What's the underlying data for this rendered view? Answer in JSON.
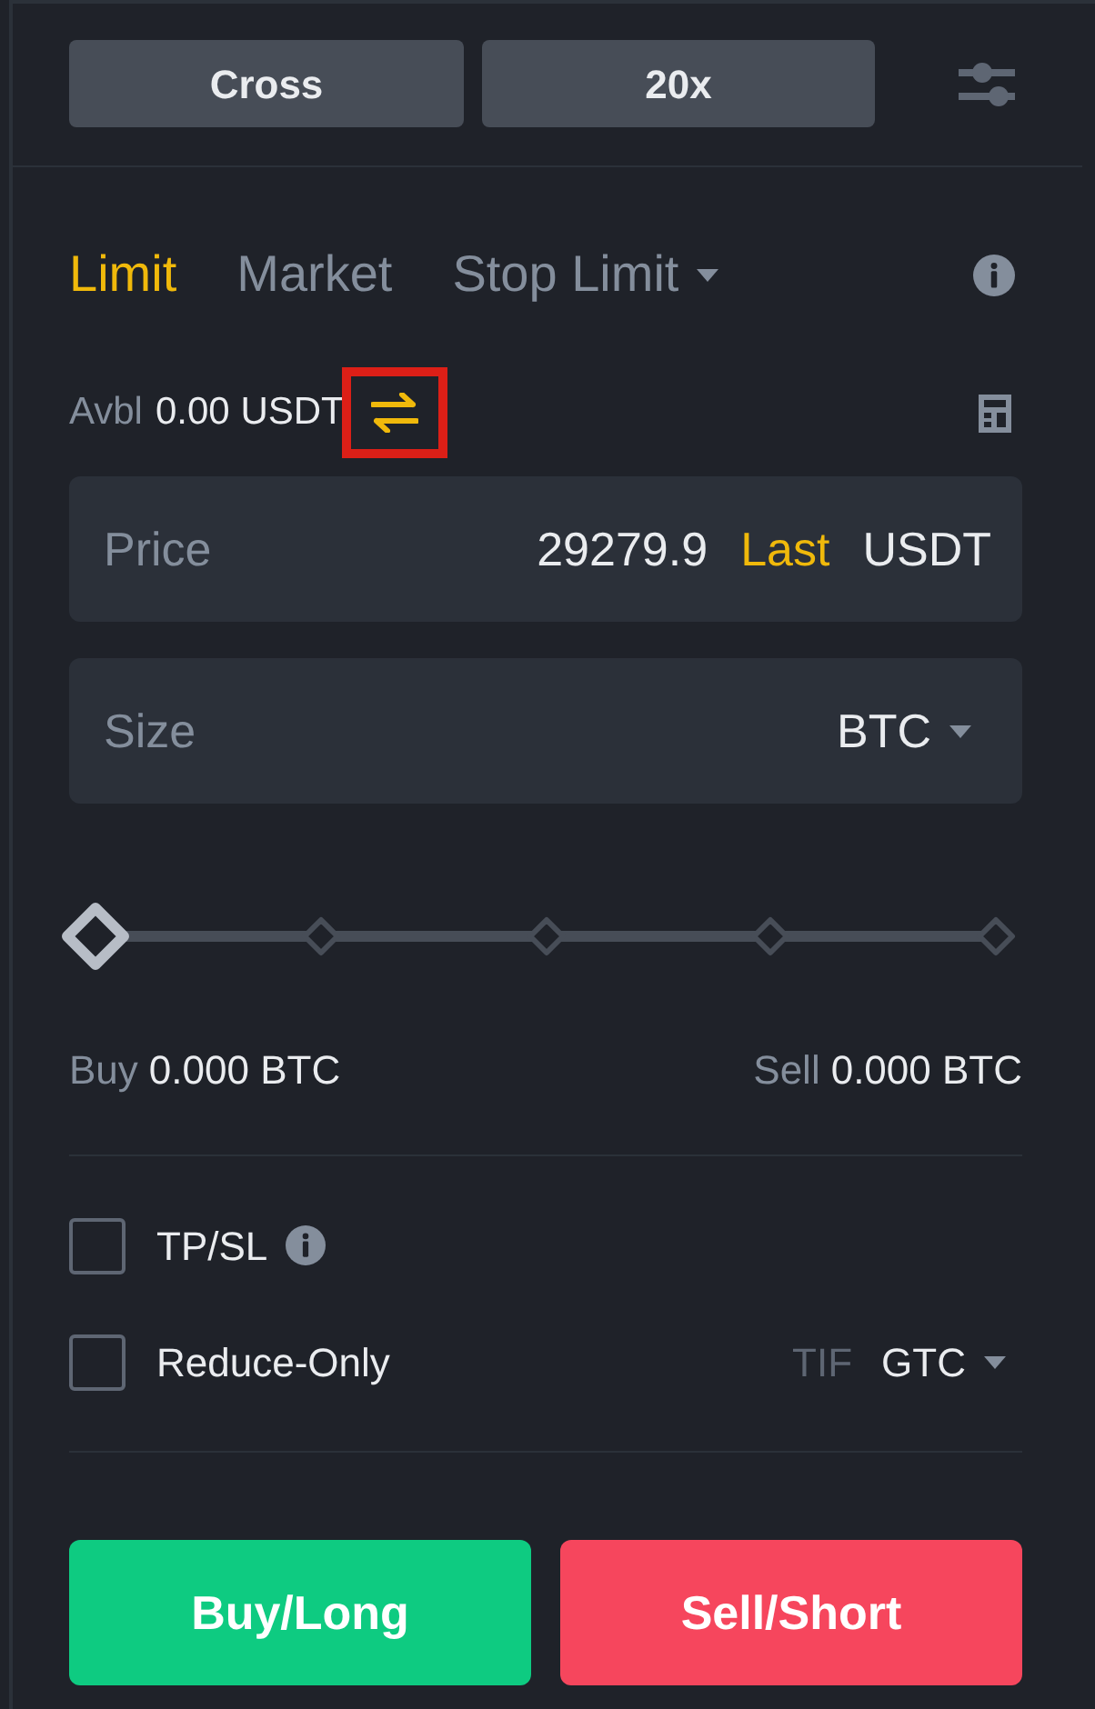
{
  "top_bar": {
    "margin_mode": "Cross",
    "leverage": "20x"
  },
  "order_types": [
    {
      "label": "Limit",
      "selected": true,
      "dropdown": false
    },
    {
      "label": "Market",
      "selected": false,
      "dropdown": false
    },
    {
      "label": "Stop Limit",
      "selected": false,
      "dropdown": true
    }
  ],
  "balance": {
    "label": "Avbl",
    "value": "0.00 USDT",
    "transfer_highlighted": true
  },
  "price_field": {
    "label": "Price",
    "value": "29279.9",
    "tag": "Last",
    "unit": "USDT"
  },
  "size_field": {
    "label": "Size",
    "unit": "BTC"
  },
  "size_slider": {
    "level": 0
  },
  "amounts": [
    {
      "label": "Buy",
      "value": "0.000 BTC"
    },
    {
      "label": "Sell",
      "value": "0.000 BTC"
    }
  ],
  "options": [
    {
      "label": "TP/SL",
      "checked": false,
      "info": true
    },
    {
      "label": "Reduce-Only",
      "checked": false,
      "info": false
    }
  ],
  "tif": {
    "label": "TIF",
    "value": "GTC"
  },
  "actions": [
    {
      "label": "Buy/Long",
      "kind": "buy"
    },
    {
      "label": "Sell/Short",
      "kind": "sell"
    }
  ]
}
